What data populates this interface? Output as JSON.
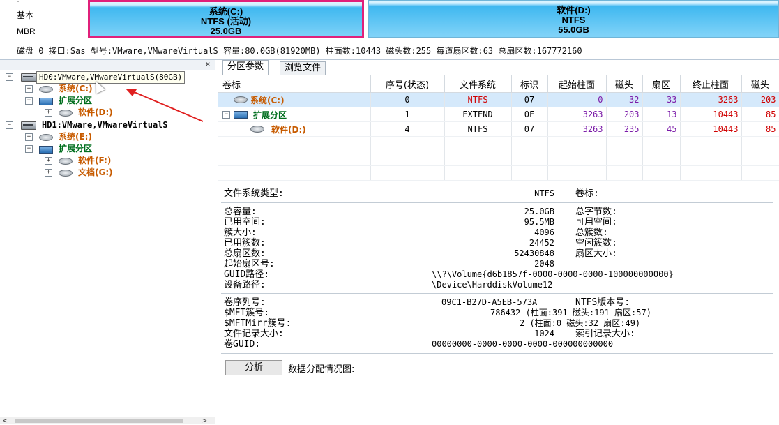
{
  "diskbar": {
    "labels": [
      "基本",
      "MBR"
    ],
    "partitions": [
      {
        "name": "系统(C:)",
        "fs": "NTFS (活动)",
        "size": "25.0GB"
      },
      {
        "name": "软件(D:)",
        "fs": "NTFS",
        "size": "55.0GB"
      }
    ],
    "info": "磁盘 0 接口:Sas  型号:VMware,VMwareVirtualS  容量:80.0GB(81920MB)  柱面数:10443  磁头数:255  每道扇区数:63  总扇区数:167772160"
  },
  "tree": {
    "close": "×",
    "tooltip": "HD0:VMware,VMwareVirtualS(80GB)",
    "nodes": [
      {
        "label": "HD0:VMware,VMwareVirtualS(80GB)",
        "kind": "disk"
      },
      {
        "label": "系统(C:)",
        "kind": "part"
      },
      {
        "label": "扩展分区",
        "kind": "ext"
      },
      {
        "label": "软件(D:)",
        "kind": "part"
      },
      {
        "label": "HD1:VMware,VMwareVirtualS",
        "kind": "disk"
      },
      {
        "label": "系统(E:)",
        "kind": "part"
      },
      {
        "label": "扩展分区",
        "kind": "ext"
      },
      {
        "label": "软件(F:)",
        "kind": "part"
      },
      {
        "label": "文档(G:)",
        "kind": "part"
      }
    ]
  },
  "tabs": [
    "分区参数",
    "浏览文件"
  ],
  "table": {
    "headers": [
      "卷标",
      "序号(状态)",
      "文件系统",
      "标识",
      "起始柱面",
      "磁头",
      "扇区",
      "终止柱面",
      "磁头"
    ],
    "rows": [
      {
        "label": "系统(C:)",
        "idx": "0",
        "fs": "NTFS",
        "id": "07",
        "sc": "0",
        "sh": "32",
        "ss": "33",
        "ec": "3263",
        "eh": "203"
      },
      {
        "label": "扩展分区",
        "idx": "1",
        "fs": "EXTEND",
        "id": "0F",
        "sc": "3263",
        "sh": "203",
        "ss": "13",
        "ec": "10443",
        "eh": "85"
      },
      {
        "label": "软件(D:)",
        "idx": "4",
        "fs": "NTFS",
        "id": "07",
        "sc": "3263",
        "sh": "235",
        "ss": "45",
        "ec": "10443",
        "eh": "85"
      }
    ]
  },
  "details": {
    "fs_type_label": "文件系统类型:",
    "fs_type_value": "NTFS",
    "volume_label": "卷标:",
    "rows1": [
      {
        "label": "总容量:",
        "value": "25.0GB",
        "label2": "总字节数:"
      },
      {
        "label": "已用空间:",
        "value": "95.5MB",
        "label2": "可用空间:"
      },
      {
        "label": "簇大小:",
        "value": "4096",
        "label2": "总簇数:"
      },
      {
        "label": "已用簇数:",
        "value": "24452",
        "label2": "空闲簇数:"
      },
      {
        "label": "总扇区数:",
        "value": "52430848",
        "label2": "扇区大小:"
      },
      {
        "label": "起始扇区号:",
        "value": "2048",
        "label2": ""
      }
    ],
    "guid_label": "GUID路径:",
    "guid_value": "\\\\?\\Volume{d6b1857f-0000-0000-0000-100000000000}",
    "device_label": "设备路径:",
    "device_value": "\\Device\\HarddiskVolume12",
    "serial_label": "卷序列号:",
    "serial_value": "09C1-B27D-A5EB-573A",
    "ntfs_ver_label": "NTFS版本号:",
    "mft_label": "$MFT簇号:",
    "mft_value": "786432 (柱面:391 磁头:191 扇区:57)",
    "mftmirr_label": "$MFTMirr簇号:",
    "mftmirr_value": "2 (柱面:0 磁头:32 扇区:49)",
    "record_label": "文件记录大小:",
    "record_value": "1024",
    "index_label": "索引记录大小:",
    "vguid_label": "卷GUID:",
    "vguid_value": "00000000-0000-0000-0000-000000000000"
  },
  "analyze_button": "分析",
  "alloc_label": "数据分配情况图:"
}
